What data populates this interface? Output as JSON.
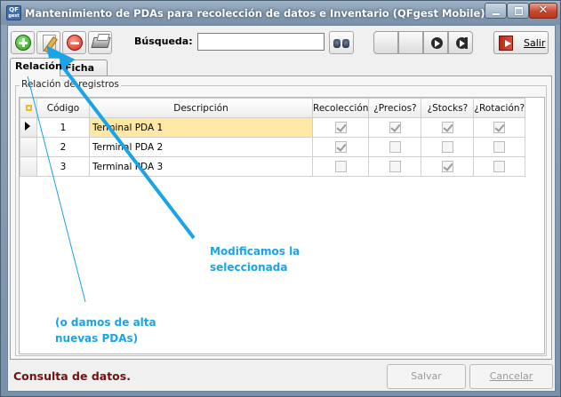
{
  "window": {
    "title": "Mantenimiento de PDAs para recolección de datos e Inventario (QFgest Mobile)",
    "app_icon_text": "QF",
    "app_icon_sub": "gest",
    "close_glyph": "✕"
  },
  "toolbar": {
    "search_label": "Búsqueda:",
    "search_value": "",
    "exit_label": "Salir"
  },
  "tabs": [
    {
      "label": "Relación",
      "active": true
    },
    {
      "label": "Ficha",
      "active": false
    }
  ],
  "group_label": "Relación de registros",
  "grid": {
    "columns": [
      "Código",
      "Descripción",
      "Recolección",
      "¿Precios?",
      "¿Stocks?",
      "¿Rotación?"
    ],
    "rows": [
      {
        "codigo": "1",
        "descripcion": "Terminal PDA 1",
        "recoleccion": true,
        "precios": true,
        "stocks": true,
        "rotacion": true,
        "selected": true
      },
      {
        "codigo": "2",
        "descripcion": "Terminal PDA 2",
        "recoleccion": true,
        "precios": false,
        "stocks": false,
        "rotacion": false,
        "selected": false
      },
      {
        "codigo": "3",
        "descripcion": "Terminal PDA 3",
        "recoleccion": false,
        "precios": false,
        "stocks": true,
        "rotacion": false,
        "selected": false
      }
    ]
  },
  "status": {
    "text": "Consulta de datos."
  },
  "bottom_buttons": {
    "save": "Salvar",
    "cancel": "Cancelar"
  },
  "annotations": {
    "modify_line1": "Modificamos la",
    "modify_line2": "seleccionada",
    "add_line1": "(o damos de alta",
    "add_line2": "nuevas PDAs)",
    "color": "#1aa3e6"
  },
  "icons": {
    "add": "add-plus-icon",
    "edit": "edit-pencil-icon",
    "delete": "delete-minus-icon",
    "print": "printer-icon",
    "find": "binoculars-icon",
    "exit": "exit-door-icon"
  }
}
